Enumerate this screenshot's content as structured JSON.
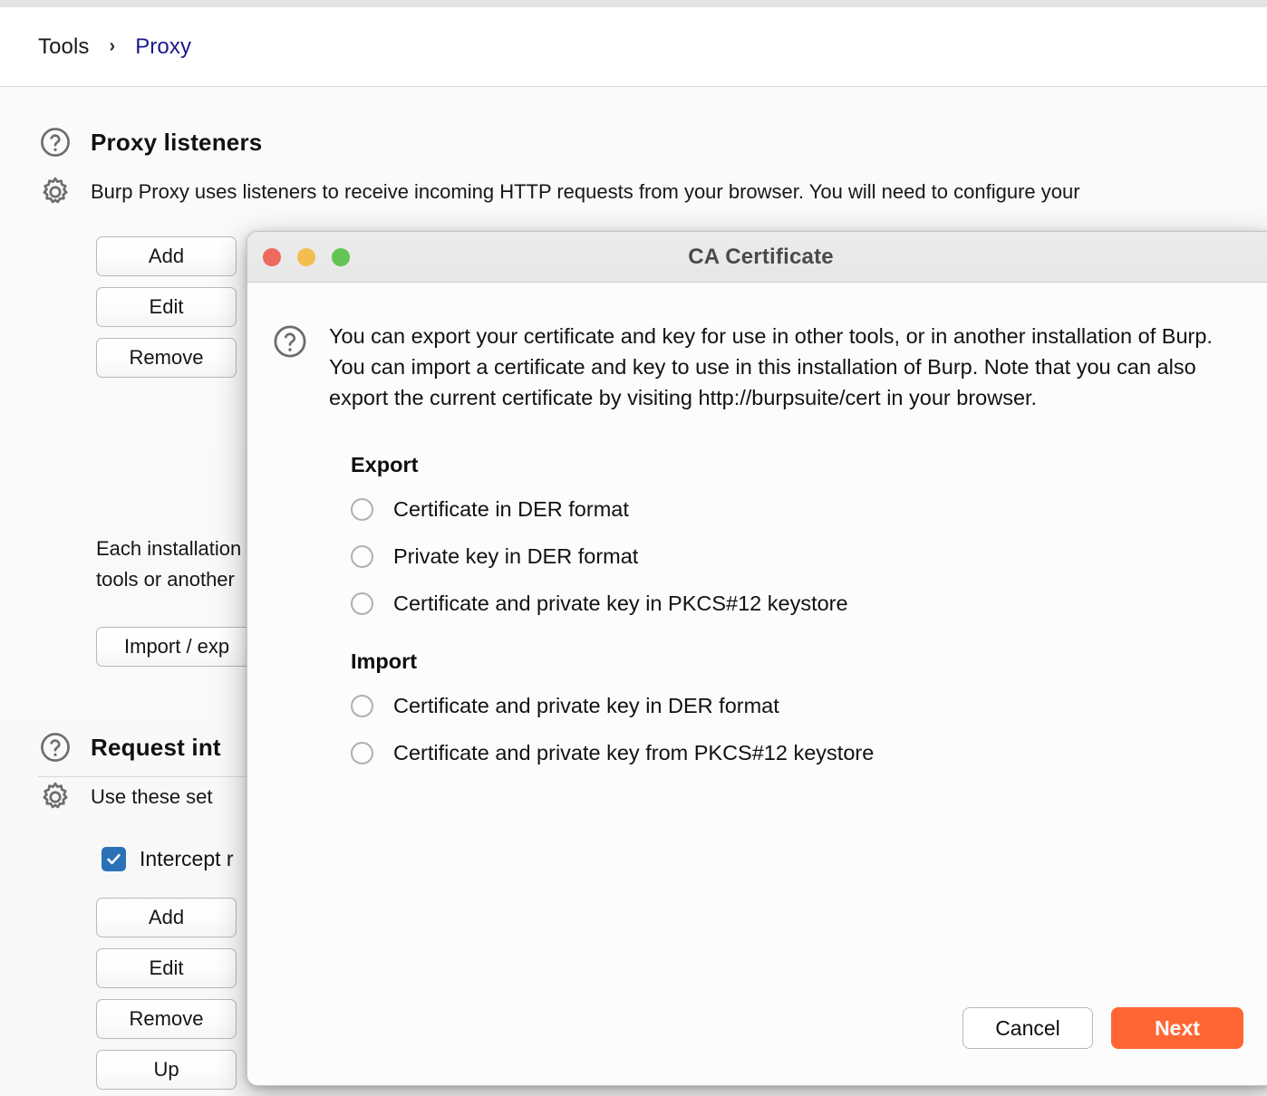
{
  "breadcrumb": {
    "root": "Tools",
    "separator": "›",
    "current": "Proxy"
  },
  "background": {
    "proxy_listeners": {
      "title": "Proxy listeners",
      "description": "Burp Proxy uses listeners to receive incoming HTTP requests from your browser. You will need to configure your",
      "buttons": [
        "Add",
        "Edit",
        "Remove"
      ],
      "ca_paragraph_line1": "Each installation",
      "ca_paragraph_line2": "tools or another",
      "import_export_button": "Import / exp"
    },
    "request_interception": {
      "title": "Request int",
      "description": "Use these set",
      "checkbox_label": "Intercept r",
      "checkbox_checked": true,
      "buttons": [
        "Add",
        "Edit",
        "Remove",
        "Up"
      ]
    }
  },
  "dialog": {
    "title": "CA Certificate",
    "intro": "You can export your certificate and key for use in other tools, or in another installation of Burp. You can import a certificate and key to use in this installation of Burp. Note that you can also export the current certificate by visiting http://burpsuite/cert in your browser.",
    "export": {
      "heading": "Export",
      "options": [
        "Certificate in DER format",
        "Private key in DER format",
        "Certificate and private key in PKCS#12 keystore"
      ]
    },
    "import": {
      "heading": "Import",
      "options": [
        "Certificate and private key in DER format",
        "Certificate and private key from PKCS#12 keystore"
      ]
    },
    "footer": {
      "cancel_label": "Cancel",
      "next_label": "Next"
    },
    "selected_option": null
  },
  "colors": {
    "accent_orange": "#FF6633",
    "link_blue": "#1A1A8C",
    "checkbox_blue": "#2B71B8",
    "traffic_red": "#EC6A5E",
    "traffic_amber": "#F4BD4F",
    "traffic_green": "#61C454"
  }
}
